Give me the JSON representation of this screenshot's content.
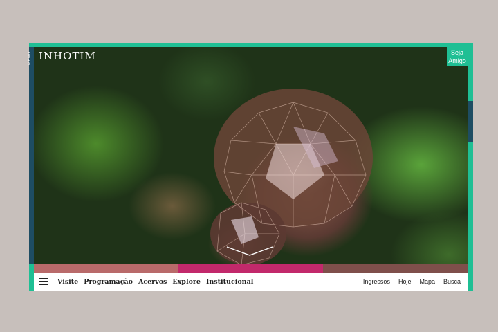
{
  "brand": {
    "logo": "INHOTIM",
    "menu_vertical": "MENU"
  },
  "hero": {
    "cta": "Seja Amigo"
  },
  "color_bar": [
    "#b96a6a",
    "#c2296b",
    "#7f4f4b"
  ],
  "nav": {
    "left": [
      "Visite",
      "Programação",
      "Acervos",
      "Explore",
      "Institucional"
    ],
    "right": [
      "Ingressos",
      "Hoje",
      "Mapa",
      "Busca"
    ]
  },
  "icons": {
    "menu": "hamburger-icon",
    "scroll": "chevron-down-icon"
  }
}
